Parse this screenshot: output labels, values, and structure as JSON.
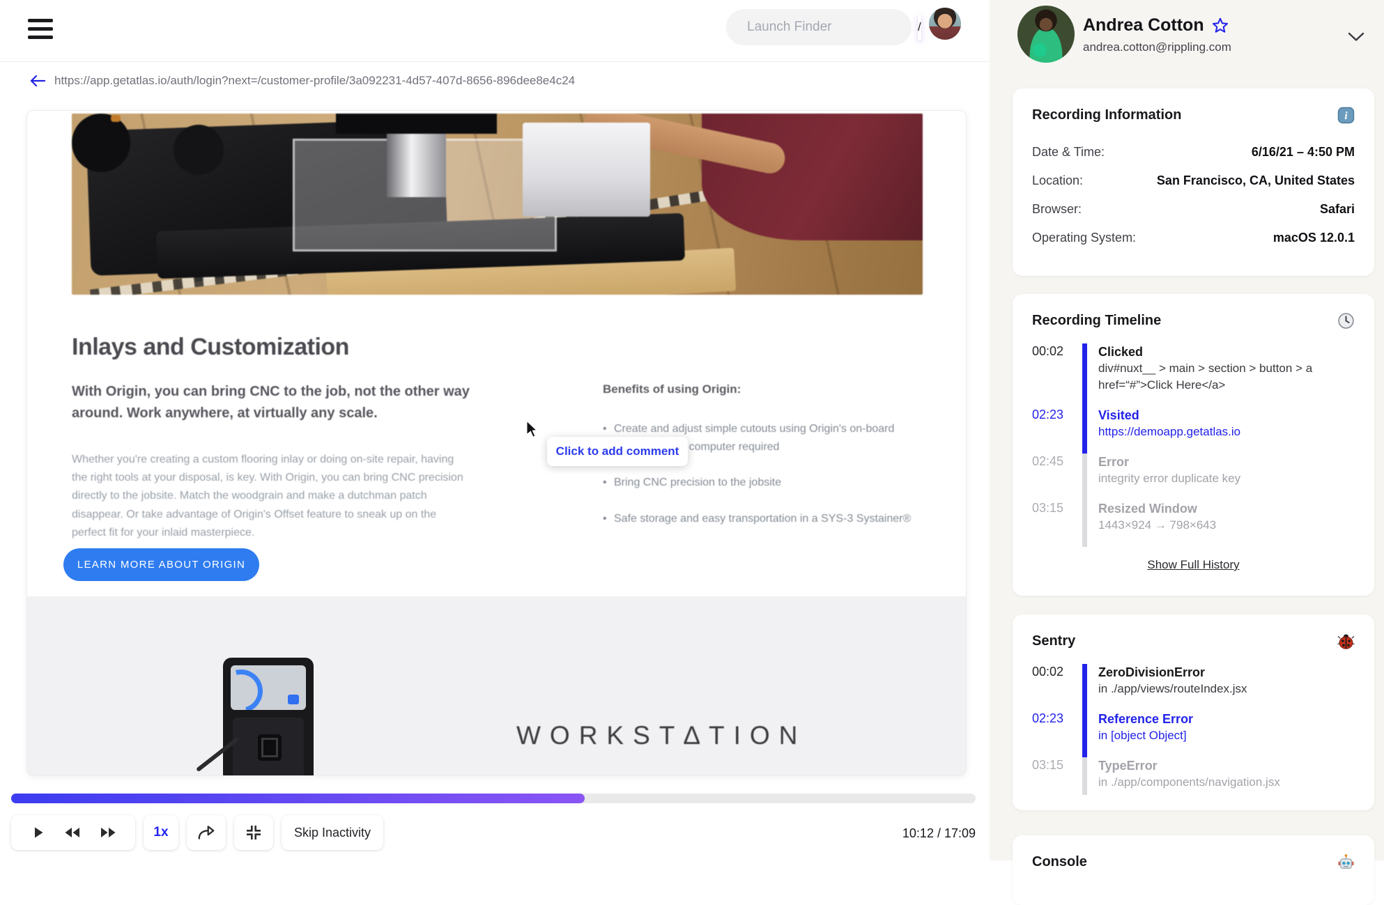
{
  "topbar": {
    "search_placeholder": "Launch Finder",
    "search_shortcut_key": "/"
  },
  "url_bar": {
    "url": "https://app.getatlas.io/auth/login?next=/customer-profile/3a092231-4d57-407d-8656-896dee8e4c24"
  },
  "replay_page": {
    "heading": "Inlays and Customization",
    "intro": "With Origin, you can bring CNC to the job, not the other way around. Work anywhere, at virtually any scale.",
    "body": "Whether you're creating a custom flooring inlay or doing on-site repair, having the right tools at your disposal, is key. With Origin, you can bring CNC precision directly to the jobsite. Match the woodgrain and make a dutchman patch disappear. Or take advantage of Origin's Offset feature to sneak up on the perfect fit for your inlaid masterpiece.",
    "benefits_heading": "Benefits of using Origin:",
    "benefits": [
      "Create and adjust simple cutouts using Origin's on-board software — no computer required",
      "Bring CNC precision to the jobsite",
      "Safe storage and easy transportation in a SYS-3 Systainer®"
    ],
    "cta_label": "LEARN MORE ABOUT ORIGIN",
    "brand_text": "WORKST∆TION",
    "comment_tooltip": "Click to add comment"
  },
  "player": {
    "speed_label": "1x",
    "skip_inactivity_label": "Skip Inactivity",
    "time_display": "10:12 / 17:09",
    "progress_percent": 59.5
  },
  "sidebar": {
    "user": {
      "name": "Andrea Cotton",
      "email": "andrea.cotton@rippling.com"
    },
    "recording_information": {
      "title": "Recording Information",
      "rows": [
        {
          "label": "Date & Time:",
          "value": "6/16/21 – 4:50 PM"
        },
        {
          "label": "Location:",
          "value": "San Francisco, CA, United States"
        },
        {
          "label": "Browser:",
          "value": "Safari"
        },
        {
          "label": "Operating System:",
          "value": "macOS 12.0.1"
        }
      ]
    },
    "recording_timeline": {
      "title": "Recording Timeline",
      "events": [
        {
          "time": "00:02",
          "title": "Clicked",
          "lines": [
            "div#nuxt__ > main > section > button > a",
            "href=“#”>Click Here</a>"
          ]
        },
        {
          "time": "02:23",
          "title": "Visited",
          "lines": [
            "https://demoapp.getatlas.io"
          ]
        },
        {
          "time": "02:45",
          "title": "Error",
          "lines": [
            "integrity error duplicate key"
          ]
        },
        {
          "time": "03:15",
          "title": "Resized Window",
          "lines": [
            "1443×924 → 798×643"
          ]
        }
      ],
      "show_full_history_label": "Show Full History"
    },
    "sentry": {
      "title": "Sentry",
      "events": [
        {
          "time": "00:02",
          "title": "ZeroDivisionError",
          "lines": [
            "in ./app/views/routeIndex.jsx"
          ]
        },
        {
          "time": "02:23",
          "title": "Reference Error",
          "lines": [
            "in [object Object]"
          ]
        },
        {
          "time": "03:15",
          "title": "TypeError",
          "lines": [
            "in ./app/components/navigation.jsx"
          ]
        }
      ]
    },
    "console": {
      "title": "Console"
    }
  },
  "colors": {
    "accent_blue": "#2222e9",
    "cta_blue": "#2e7cf0",
    "status_green": "#1ecb8c",
    "progress_gradient": [
      "#3c3cf0",
      "#8a55f4"
    ],
    "inactive_gray": "#a2a2a9"
  },
  "icons": {
    "hamburger": "menu-icon",
    "search": "magnifier-icon",
    "back": "left-arrow-icon",
    "info_panel": "info-emoji-icon",
    "timeline_panel": "clock-emoji-icon",
    "sentry_panel": "ladybug-emoji-icon",
    "console_panel": "robot-emoji-icon",
    "favorite": "star-outline-icon",
    "expand_user": "chevron-down-icon",
    "play": "play-icon",
    "rewind": "rewind-icon",
    "forward": "fast-forward-icon",
    "share": "skip-forward-arrow-icon",
    "collapse": "collapse-view-icon",
    "cursor": "pointer-cursor-icon"
  }
}
